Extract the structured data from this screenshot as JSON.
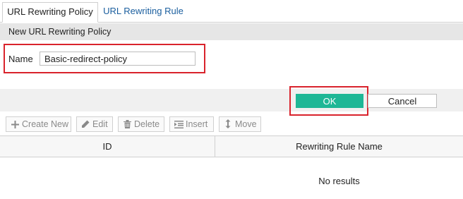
{
  "tabs": [
    {
      "label": "URL Rewriting Policy",
      "active": true
    },
    {
      "label": "URL Rewriting Rule",
      "active": false
    }
  ],
  "form": {
    "header": "New URL Rewriting Policy",
    "name_label": "Name",
    "name_value": "Basic-redirect-policy"
  },
  "actions": {
    "ok_label": "OK",
    "cancel_label": "Cancel"
  },
  "toolbar": {
    "create_new": "Create New",
    "edit": "Edit",
    "delete": "Delete",
    "insert": "Insert",
    "move": "Move"
  },
  "table": {
    "columns": [
      "ID",
      "Rewriting Rule Name"
    ],
    "empty_text": "No results"
  },
  "colors": {
    "accent_ok": "#1eb796",
    "highlight_border": "#d9232c",
    "link": "#1a5e9e"
  },
  "icons": [
    "plus-icon",
    "pencil-icon",
    "trash-icon",
    "insert-icon",
    "move-arrows-icon"
  ]
}
